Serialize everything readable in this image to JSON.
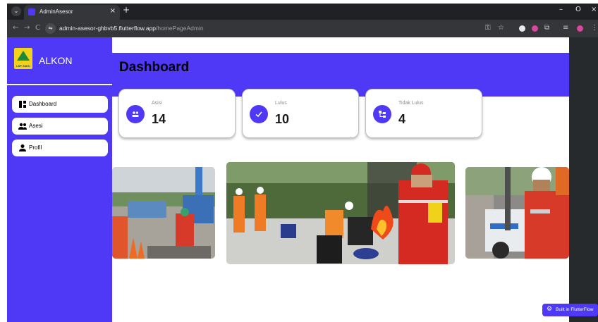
{
  "browser": {
    "tab_title": "AdminAsesor",
    "tab_close": "×",
    "new_tab": "+",
    "dropdown": "⌄",
    "url_host": "admin-asesor-ghbvb5.flutterflow.app",
    "url_path": "/homePageAdmin",
    "back": "←",
    "forward": "→",
    "reload": "C",
    "site_info": "⇋",
    "key": "⚿",
    "star": "☆",
    "extensions": "⧉",
    "media": "≡",
    "menu": "⋮",
    "win_min": "–",
    "win_max": "O",
    "win_close": "×"
  },
  "sidebar": {
    "brand": "ALKON",
    "logo_text": "LSP-TAKU",
    "items": [
      {
        "label": "Dashboard",
        "icon": "dashboard-icon"
      },
      {
        "label": "Asesi",
        "icon": "people-icon"
      },
      {
        "label": "Profil",
        "icon": "person-icon"
      }
    ]
  },
  "main": {
    "title": "Dashboard",
    "stats": [
      {
        "label": "Asisi",
        "value": "14",
        "icon": "group-icon"
      },
      {
        "label": "Lulus",
        "value": "10",
        "icon": "check-icon"
      },
      {
        "label": "Tidak Lulus",
        "value": "4",
        "icon": "tree-icon"
      }
    ]
  },
  "footer_badge": "Built in FlutterFlow",
  "colors": {
    "primary": "#4f39f6",
    "chrome_dark": "#202124",
    "chrome_toolbar": "#35363a",
    "right_panel": "#262a2d"
  }
}
